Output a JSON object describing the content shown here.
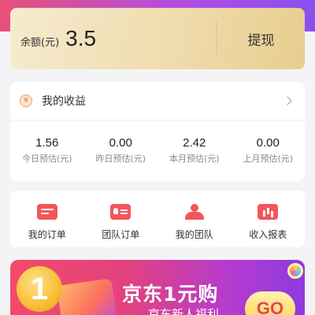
{
  "balance": {
    "label": "余额(元)",
    "value": "3.5",
    "withdraw_label": "提现"
  },
  "earnings": {
    "title": "我的收益",
    "stats": [
      {
        "value": "1.56",
        "label": "今日预估(元)"
      },
      {
        "value": "0.00",
        "label": "昨日预估(元)"
      },
      {
        "value": "2.42",
        "label": "本月预估(元)"
      },
      {
        "value": "0.00",
        "label": "上月预估(元)"
      }
    ]
  },
  "orders": {
    "items": [
      {
        "label": "我的订单",
        "icon": "order-list-icon"
      },
      {
        "label": "团队订单",
        "icon": "team-order-icon"
      },
      {
        "label": "我的团队",
        "icon": "team-icon"
      },
      {
        "label": "收入报表",
        "icon": "report-chart-icon"
      }
    ]
  },
  "banner": {
    "coin_text": "1",
    "title": "京东1元购",
    "subtitle": "京东新人福利",
    "go_label": "GO"
  },
  "colors": {
    "header_gradient_start": "#e9507a",
    "header_gradient_end": "#8a4ff0",
    "balance_card": "#efdcad",
    "icon_red": "#f2565b",
    "banner_pink": "#f24a6a",
    "banner_purple": "#8e3ae0"
  }
}
